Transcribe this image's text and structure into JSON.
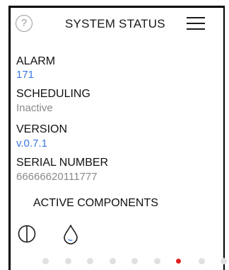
{
  "header": {
    "title": "SYSTEM STATUS",
    "help_glyph": "?",
    "help_icon": "help-circle-icon",
    "menu_icon": "hamburger-menu-icon"
  },
  "fields": [
    {
      "label": "ALARM",
      "value": "171",
      "value_color": "#3a78e0"
    },
    {
      "label": "SCHEDULING",
      "value": "Inactive",
      "value_color": "#8a8a8a"
    },
    {
      "label": "VERSION",
      "value": "v.0.7.1",
      "value_color": "#3a78e0"
    },
    {
      "label": "SERIAL NUMBER",
      "value": "66666620111777",
      "value_color": "#8a8a8a"
    }
  ],
  "components": {
    "title": "ACTIVE COMPONENTS",
    "icons": [
      "half-circle-icon",
      "water-drop-icon"
    ]
  },
  "pagination": {
    "total": 9,
    "active_index": 6,
    "active_color": "#e02020",
    "inactive_color": "#e0e0e0"
  }
}
